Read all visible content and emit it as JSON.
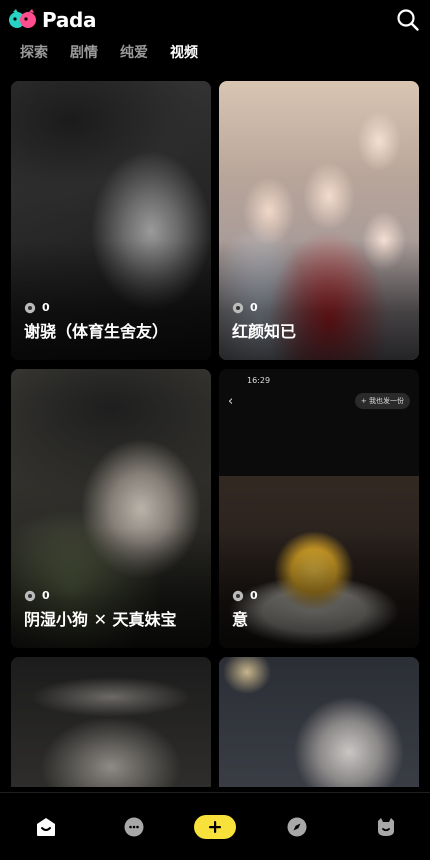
{
  "app": {
    "name": "Pada"
  },
  "tabs": [
    {
      "label": "探索",
      "active": false
    },
    {
      "label": "剧情",
      "active": false
    },
    {
      "label": "纯爱",
      "active": false
    },
    {
      "label": "视频",
      "active": true
    }
  ],
  "cards": [
    {
      "title": "谢骁（体育生舍友）",
      "count": "0"
    },
    {
      "title": "红颜知已",
      "count": "0"
    },
    {
      "title": "阴湿小狗 ✕ 天真妹宝",
      "count": "0"
    },
    {
      "title": "意",
      "count": "0"
    },
    {
      "title": "",
      "count": ""
    },
    {
      "title": "",
      "count": ""
    }
  ],
  "phone_overlay": {
    "time": "16:29",
    "action": "+ 我也发一份"
  },
  "bottom_nav": [
    "home-icon",
    "chat-icon",
    "create-button",
    "compass-icon",
    "profile-icon"
  ],
  "colors": {
    "accent": "#f7e13a",
    "background": "#000000",
    "logo_pink": "#ff4d8d",
    "logo_teal": "#29d3c4"
  }
}
